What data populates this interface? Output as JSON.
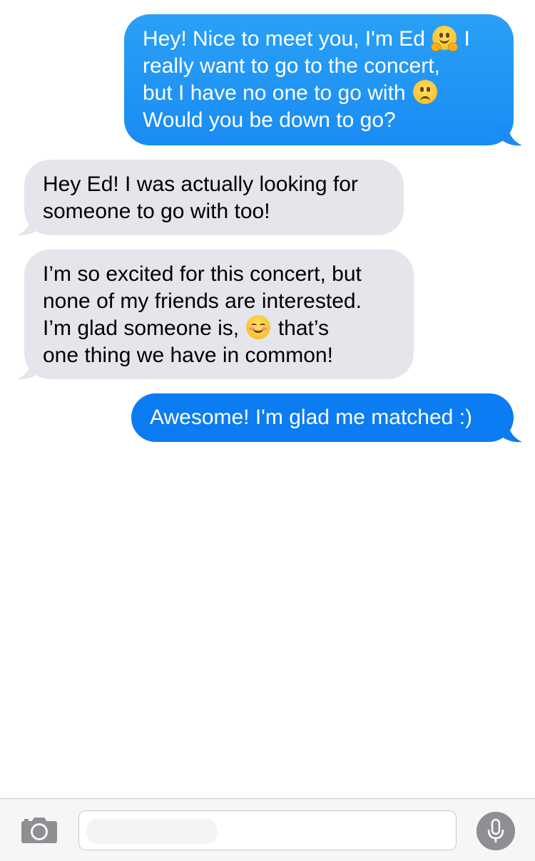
{
  "colors": {
    "sent_bubble_top": "#2aa0f6",
    "sent_bubble_bottom": "#1a82f0",
    "sent_bubble_solid": "#0b7cf1",
    "received_bubble": "#e6e5eb",
    "toolbar_bg": "#f6f6f7",
    "mic_bg": "#8e8e93"
  },
  "messages": [
    {
      "direction": "sent",
      "lines": [
        {
          "text": "Hey! Nice to meet you, I'm Ed",
          "emoji": "hugging-face",
          "after": " I"
        },
        {
          "text": "really want to go to the concert,"
        },
        {
          "text": "but I have no one to go with",
          "emoji": "confused-face"
        },
        {
          "text": "Would you be down to go?"
        }
      ]
    },
    {
      "direction": "received",
      "lines": [
        {
          "text": "Hey Ed! I was actually looking for"
        },
        {
          "text": "someone to go with too!"
        }
      ]
    },
    {
      "direction": "received",
      "lines": [
        {
          "text": "I’m so excited for this concert, but"
        },
        {
          "text": "none of my friends are interested."
        },
        {
          "text": "I’m glad someone is,",
          "emoji": "smiling-blush-face",
          "after": " that’s"
        },
        {
          "text": "one thing we have in common!"
        }
      ]
    },
    {
      "direction": "sent",
      "lines": [
        {
          "text": "Awesome! I'm glad me matched :)"
        }
      ]
    }
  ],
  "toolbar": {
    "camera_icon": "camera-icon",
    "message_placeholder": "",
    "mic_icon": "microphone-icon"
  }
}
